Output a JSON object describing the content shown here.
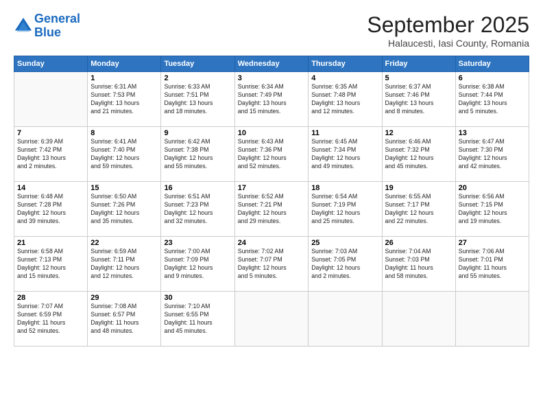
{
  "logo": {
    "line1": "General",
    "line2": "Blue"
  },
  "title": "September 2025",
  "location": "Halaucesti, Iasi County, Romania",
  "weekdays": [
    "Sunday",
    "Monday",
    "Tuesday",
    "Wednesday",
    "Thursday",
    "Friday",
    "Saturday"
  ],
  "weeks": [
    [
      {
        "day": "",
        "info": ""
      },
      {
        "day": "1",
        "info": "Sunrise: 6:31 AM\nSunset: 7:53 PM\nDaylight: 13 hours\nand 21 minutes."
      },
      {
        "day": "2",
        "info": "Sunrise: 6:33 AM\nSunset: 7:51 PM\nDaylight: 13 hours\nand 18 minutes."
      },
      {
        "day": "3",
        "info": "Sunrise: 6:34 AM\nSunset: 7:49 PM\nDaylight: 13 hours\nand 15 minutes."
      },
      {
        "day": "4",
        "info": "Sunrise: 6:35 AM\nSunset: 7:48 PM\nDaylight: 13 hours\nand 12 minutes."
      },
      {
        "day": "5",
        "info": "Sunrise: 6:37 AM\nSunset: 7:46 PM\nDaylight: 13 hours\nand 8 minutes."
      },
      {
        "day": "6",
        "info": "Sunrise: 6:38 AM\nSunset: 7:44 PM\nDaylight: 13 hours\nand 5 minutes."
      }
    ],
    [
      {
        "day": "7",
        "info": "Sunrise: 6:39 AM\nSunset: 7:42 PM\nDaylight: 13 hours\nand 2 minutes."
      },
      {
        "day": "8",
        "info": "Sunrise: 6:41 AM\nSunset: 7:40 PM\nDaylight: 12 hours\nand 59 minutes."
      },
      {
        "day": "9",
        "info": "Sunrise: 6:42 AM\nSunset: 7:38 PM\nDaylight: 12 hours\nand 55 minutes."
      },
      {
        "day": "10",
        "info": "Sunrise: 6:43 AM\nSunset: 7:36 PM\nDaylight: 12 hours\nand 52 minutes."
      },
      {
        "day": "11",
        "info": "Sunrise: 6:45 AM\nSunset: 7:34 PM\nDaylight: 12 hours\nand 49 minutes."
      },
      {
        "day": "12",
        "info": "Sunrise: 6:46 AM\nSunset: 7:32 PM\nDaylight: 12 hours\nand 45 minutes."
      },
      {
        "day": "13",
        "info": "Sunrise: 6:47 AM\nSunset: 7:30 PM\nDaylight: 12 hours\nand 42 minutes."
      }
    ],
    [
      {
        "day": "14",
        "info": "Sunrise: 6:48 AM\nSunset: 7:28 PM\nDaylight: 12 hours\nand 39 minutes."
      },
      {
        "day": "15",
        "info": "Sunrise: 6:50 AM\nSunset: 7:26 PM\nDaylight: 12 hours\nand 35 minutes."
      },
      {
        "day": "16",
        "info": "Sunrise: 6:51 AM\nSunset: 7:23 PM\nDaylight: 12 hours\nand 32 minutes."
      },
      {
        "day": "17",
        "info": "Sunrise: 6:52 AM\nSunset: 7:21 PM\nDaylight: 12 hours\nand 29 minutes."
      },
      {
        "day": "18",
        "info": "Sunrise: 6:54 AM\nSunset: 7:19 PM\nDaylight: 12 hours\nand 25 minutes."
      },
      {
        "day": "19",
        "info": "Sunrise: 6:55 AM\nSunset: 7:17 PM\nDaylight: 12 hours\nand 22 minutes."
      },
      {
        "day": "20",
        "info": "Sunrise: 6:56 AM\nSunset: 7:15 PM\nDaylight: 12 hours\nand 19 minutes."
      }
    ],
    [
      {
        "day": "21",
        "info": "Sunrise: 6:58 AM\nSunset: 7:13 PM\nDaylight: 12 hours\nand 15 minutes."
      },
      {
        "day": "22",
        "info": "Sunrise: 6:59 AM\nSunset: 7:11 PM\nDaylight: 12 hours\nand 12 minutes."
      },
      {
        "day": "23",
        "info": "Sunrise: 7:00 AM\nSunset: 7:09 PM\nDaylight: 12 hours\nand 9 minutes."
      },
      {
        "day": "24",
        "info": "Sunrise: 7:02 AM\nSunset: 7:07 PM\nDaylight: 12 hours\nand 5 minutes."
      },
      {
        "day": "25",
        "info": "Sunrise: 7:03 AM\nSunset: 7:05 PM\nDaylight: 12 hours\nand 2 minutes."
      },
      {
        "day": "26",
        "info": "Sunrise: 7:04 AM\nSunset: 7:03 PM\nDaylight: 11 hours\nand 58 minutes."
      },
      {
        "day": "27",
        "info": "Sunrise: 7:06 AM\nSunset: 7:01 PM\nDaylight: 11 hours\nand 55 minutes."
      }
    ],
    [
      {
        "day": "28",
        "info": "Sunrise: 7:07 AM\nSunset: 6:59 PM\nDaylight: 11 hours\nand 52 minutes."
      },
      {
        "day": "29",
        "info": "Sunrise: 7:08 AM\nSunset: 6:57 PM\nDaylight: 11 hours\nand 48 minutes."
      },
      {
        "day": "30",
        "info": "Sunrise: 7:10 AM\nSunset: 6:55 PM\nDaylight: 11 hours\nand 45 minutes."
      },
      {
        "day": "",
        "info": ""
      },
      {
        "day": "",
        "info": ""
      },
      {
        "day": "",
        "info": ""
      },
      {
        "day": "",
        "info": ""
      }
    ]
  ]
}
